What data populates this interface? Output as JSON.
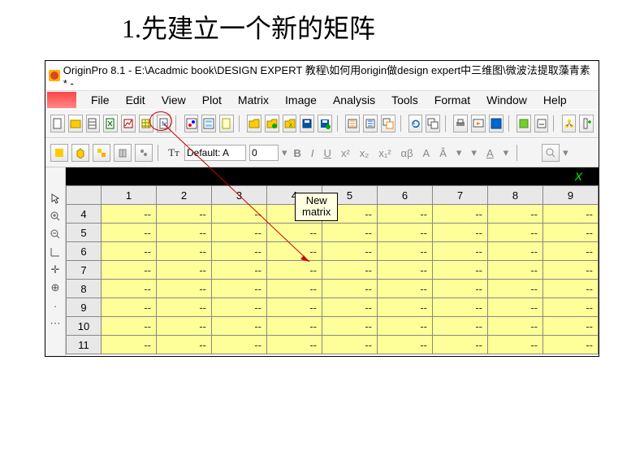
{
  "slide_title": "1.先建立一个新的矩阵",
  "titlebar": "OriginPro 8.1 - E:\\Acadmic book\\DESIGN EXPERT 教程\\如何用origin做design expert中三维图\\微波法提取藻青素 * -",
  "menus": [
    "File",
    "Edit",
    "View",
    "Plot",
    "Matrix",
    "Image",
    "Analysis",
    "Tools",
    "Format",
    "Window",
    "Help"
  ],
  "font_label": "Default: A",
  "font_size": "0",
  "fmt_buttons": [
    "B",
    "I",
    "U",
    "x²",
    "x₂",
    "x₁²",
    "αβ",
    "A",
    "·",
    "·",
    "·",
    "A",
    "·"
  ],
  "tab_label": "X",
  "columns": [
    "",
    "1",
    "2",
    "3",
    "4",
    "5",
    "6",
    "7",
    "8",
    "9"
  ],
  "rows": [
    "4",
    "5",
    "6",
    "7",
    "8",
    "9",
    "10",
    "11"
  ],
  "cell_value": "--",
  "tooltip_line1": "New",
  "tooltip_line2": "matrix"
}
